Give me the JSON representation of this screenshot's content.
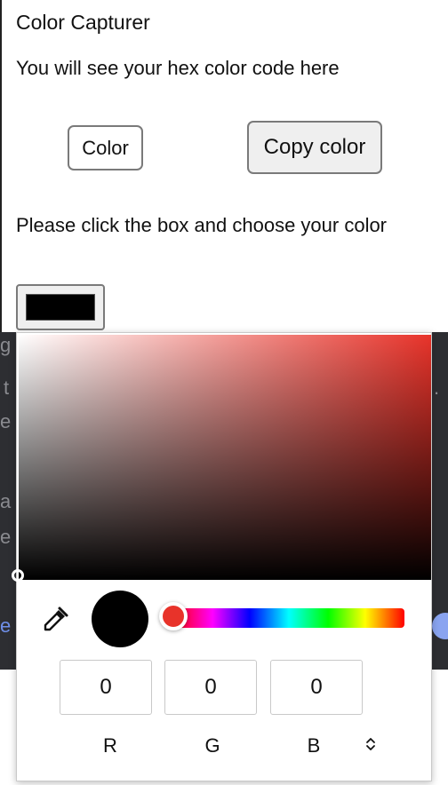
{
  "app": {
    "title": "Color Capturer",
    "hex_output": "You will see your hex color code here"
  },
  "buttons": {
    "color_label": "Color",
    "copy_label": "Copy color"
  },
  "instruction": "Please click the box and choose your color",
  "color_input": {
    "value": "#000000"
  },
  "picker": {
    "current_color": "#000000",
    "hue_color": "#e8332a",
    "hue_position": 0,
    "saturation": 0,
    "brightness": 0,
    "rgb": {
      "r": "0",
      "g": "0",
      "b": "0"
    },
    "labels": {
      "r": "R",
      "g": "G",
      "b": "B"
    },
    "icons": {
      "eyedropper": "eyedropper-icon",
      "mode_toggle": "chevron-up-down-icon"
    }
  },
  "background_page": {
    "colors": {
      "bg": "#2d2e32",
      "link": "#6f8fe8",
      "text": "#8a8b90"
    }
  }
}
